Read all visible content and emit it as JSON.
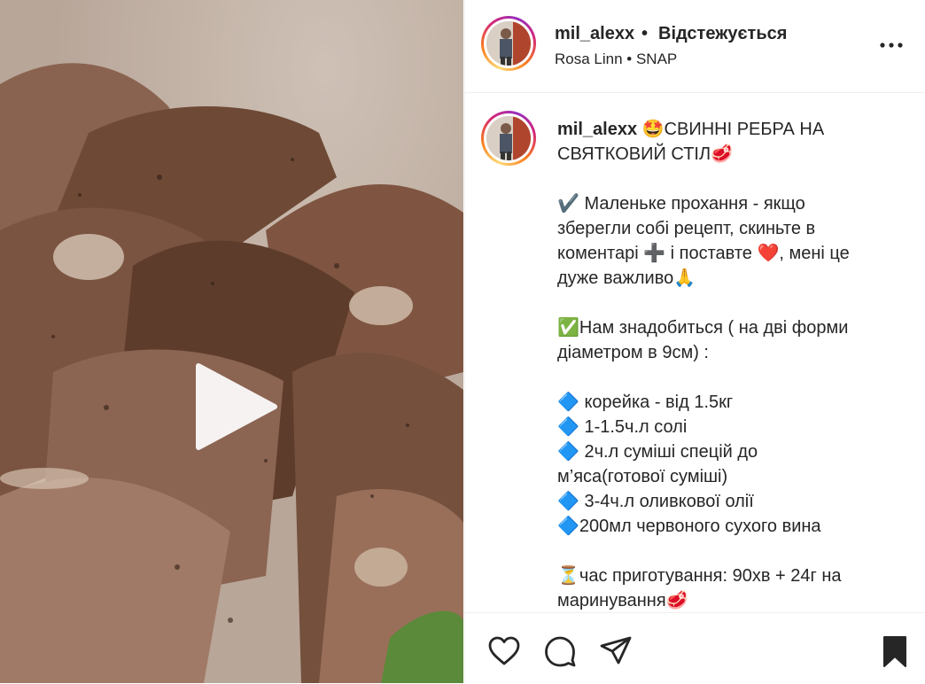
{
  "post": {
    "username": "mil_alexx",
    "separator": "•",
    "follow_status": "Відстежується",
    "audio": "Rosa Linn • SNAP"
  },
  "caption": {
    "username": "mil_alexx",
    "text": "🤩СВИННІ РЕБРА НА СВЯТКОВИЙ СТІЛ🥩\n\n✔️ Маленьке прохання - якщо зберегли собі рецепт, скиньте в коментарі ➕ і поставте ❤️, мені це дуже важливо🙏\n\n✅Нам знадобиться ( на дві форми діаметром в 9см) :\n\n🔷 корейка - від 1.5кг\n🔷 1-1.5ч.л солі\n🔷 2ч.л суміші спецій до м’яса(готової суміші)\n🔷 3-4ч.л оливкової олії\n🔷200мл червоного сухого вина\n\n⏳час приготування: 90хв + 24г на маринування🥩"
  },
  "icons": {
    "play": "play-icon",
    "more": "more-options-icon",
    "like": "heart-icon",
    "comment": "comment-icon",
    "share": "share-icon",
    "save": "bookmark-icon"
  }
}
